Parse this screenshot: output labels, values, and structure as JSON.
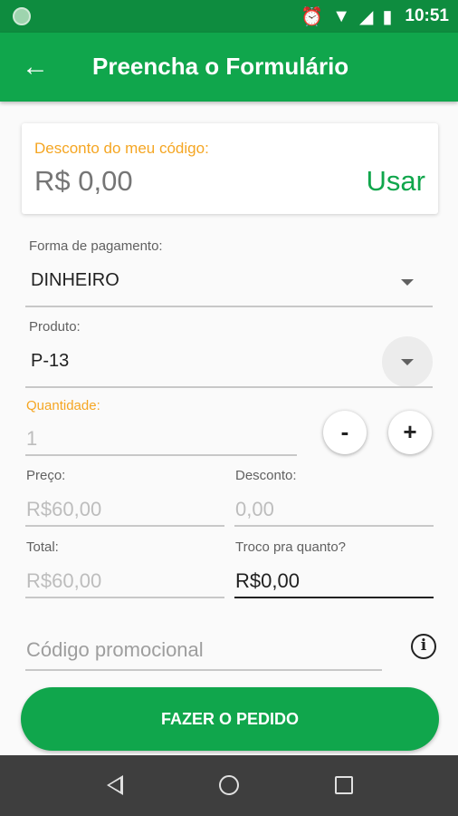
{
  "status_bar": {
    "time": "10:51",
    "icons": [
      "alarm-icon",
      "wifi-icon",
      "signal-icon",
      "battery-icon"
    ]
  },
  "app_bar": {
    "back_icon": "arrow-back-icon",
    "title": "Preencha o Formulário"
  },
  "discount_card": {
    "label": "Desconto do meu código:",
    "value": "R$ 0,00",
    "use_label": "Usar"
  },
  "payment": {
    "label": "Forma de pagamento:",
    "value": "DINHEIRO"
  },
  "product": {
    "label": "Produto:",
    "value": "P-13"
  },
  "quantity": {
    "label": "Quantidade:",
    "value": "1",
    "decrement_label": "-",
    "increment_label": "+"
  },
  "price": {
    "label": "Preço:",
    "value": "R$60,00"
  },
  "discount": {
    "label": "Desconto:",
    "value": "0,00"
  },
  "total": {
    "label": "Total:",
    "value": "R$60,00"
  },
  "change": {
    "label": "Troco pra quanto?",
    "value": "R$0,00"
  },
  "promo_code": {
    "placeholder": "Código promocional",
    "info_icon": "info-icon"
  },
  "order_button": {
    "label": "FAZER O PEDIDO"
  },
  "colors": {
    "primary": "#10a64c",
    "status_bar": "#0e8c3f",
    "accent": "#f5a623",
    "nav_bar": "#3e3e3e"
  }
}
